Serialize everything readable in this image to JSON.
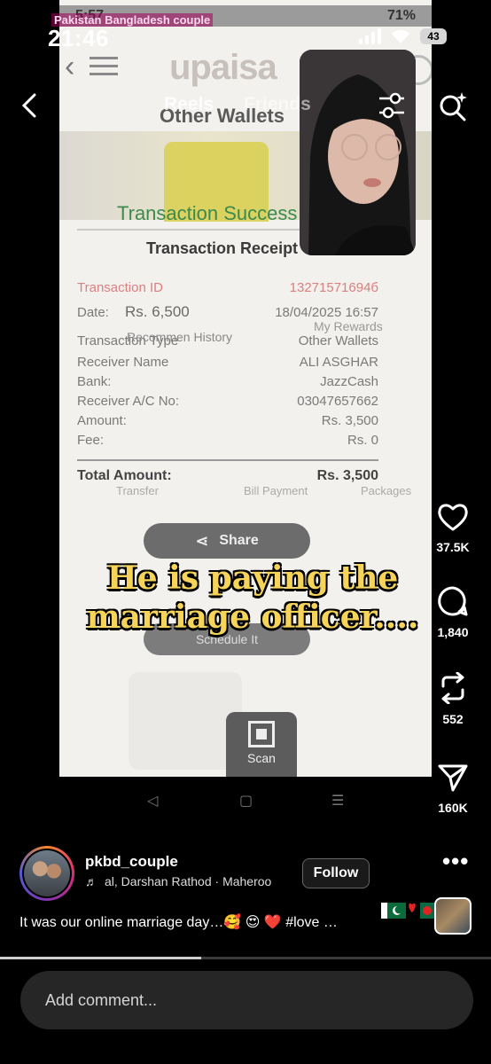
{
  "status_bar": {
    "time": "21:46",
    "battery": "43",
    "signal": "signal-icon",
    "wifi": "wifi-icon"
  },
  "video_overlay_label": "Pakistan Bangladesh couple",
  "video_phone": {
    "status_time": "5:57",
    "status_right": "71%",
    "brand": "upaisa",
    "title": "Other Wallets",
    "transaction_success": "Transaction Success",
    "receipt_title": "Transaction Receipt",
    "transaction_id_label": "Transaction ID",
    "transaction_id_value": "13271571694б",
    "date_label": "Date:",
    "date_value": "18/04/2025 16:57",
    "date_overlay_amount": "Rs. 6,500",
    "my_rewards": "My Rewards",
    "transaction_type_label": "Transaction Type",
    "transaction_type_overlay": "Recommen History",
    "transaction_type_value": "Other Wallets",
    "receiver_name_label": "Receiver Name",
    "receiver_name_value": "ALI ASGHAR",
    "bank_label": "Bank:",
    "bank_value": "JazzCash",
    "account_label": "Receiver A/C No:",
    "account_value": "03047657662",
    "amount_label": "Amount:",
    "amount_value": "Rs. 3,500",
    "fee_label": "Fee:",
    "fee_value": "Rs. 0",
    "total_label": "Total Amount:",
    "total_value": "Rs. 3,500",
    "ghost_transfer": "Transfer",
    "ghost_bill": "Bill Payment",
    "ghost_packages": "Packages",
    "share_label": "Share",
    "schedule_label": "Schedule It",
    "scan_label": "Scan"
  },
  "header": {
    "tab_reels": "Reels",
    "tab_friends": "Friends"
  },
  "caption": {
    "line1": "He is paying the",
    "line2": "marriage officer...."
  },
  "actions": {
    "likes": "37.5K",
    "comments": "1,840",
    "reposts": "552",
    "shares": "160K"
  },
  "post": {
    "username": "pkbd_couple",
    "audio": "al, Darshan Rathod · Maheroo",
    "follow_label": "Follow",
    "description": "It was our online marriage day…🥰 😍 ❤️ #love …",
    "progress": 0.41
  },
  "comment": {
    "placeholder": "Add comment..."
  }
}
